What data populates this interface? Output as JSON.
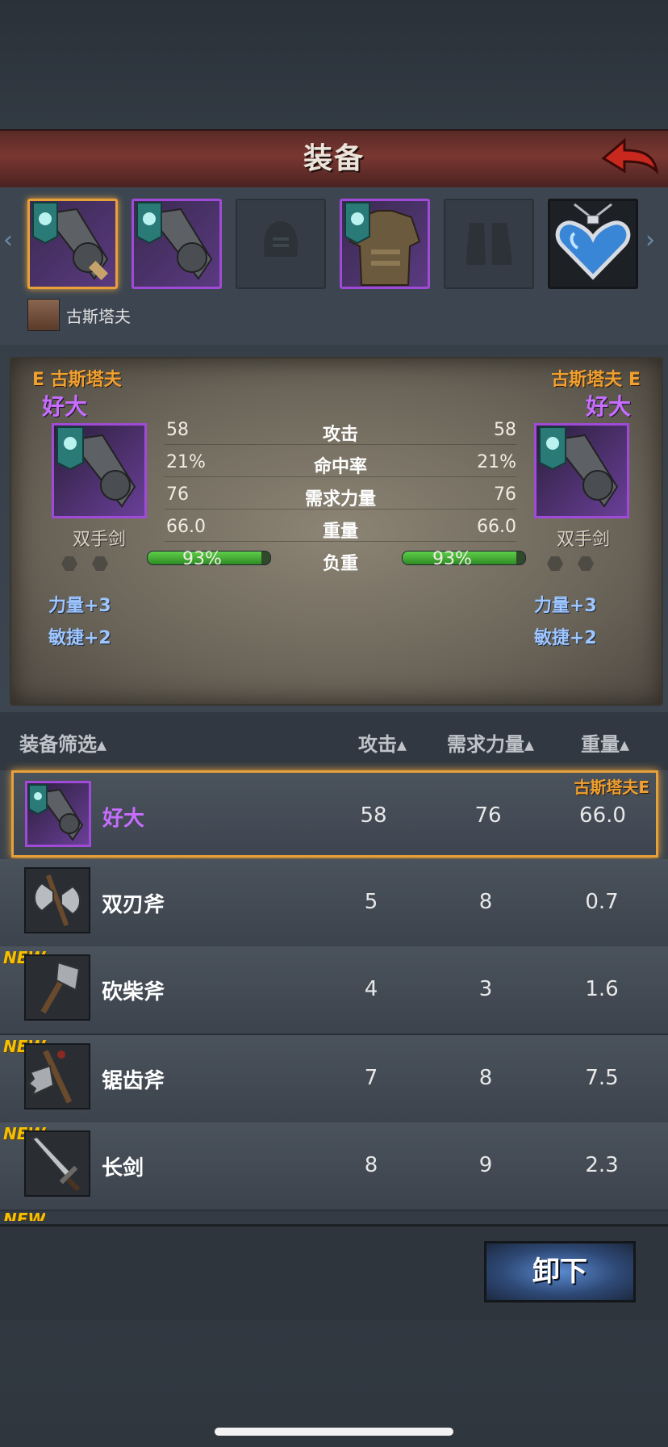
{
  "header": {
    "title": "装备",
    "back": "back"
  },
  "hero": {
    "name": "古斯塔夫"
  },
  "compare": {
    "left": {
      "owner": "E 古斯塔夫",
      "item_name": "好大",
      "type": "双手剑",
      "stats": [
        "58",
        "21%",
        "76",
        "66.0"
      ],
      "load_pct": "93%",
      "load_fraction": 0.93,
      "bonuses": [
        "力量+3",
        "敏捷+2"
      ]
    },
    "right": {
      "owner": "古斯塔夫 E",
      "item_name": "好大",
      "type": "双手剑",
      "stats": [
        "58",
        "21%",
        "76",
        "66.0"
      ],
      "load_pct": "93%",
      "load_fraction": 0.93,
      "bonuses": [
        "力量+3",
        "敏捷+2"
      ]
    },
    "labels": [
      "攻击",
      "命中率",
      "需求力量",
      "重量",
      "负重"
    ]
  },
  "list": {
    "headers": {
      "filter": "装备筛选",
      "attack": "攻击",
      "strength": "需求力量",
      "weight": "重量"
    },
    "selected_owner": "古斯塔夫E",
    "new_label": "NEW",
    "items": [
      {
        "name": "好大",
        "attack": "58",
        "strength": "76",
        "weight": "66.0"
      },
      {
        "name": "双刃斧",
        "attack": "5",
        "strength": "8",
        "weight": "0.7"
      },
      {
        "name": "砍柴斧",
        "attack": "4",
        "strength": "3",
        "weight": "1.6"
      },
      {
        "name": "锯齿斧",
        "attack": "7",
        "strength": "8",
        "weight": "7.5"
      },
      {
        "name": "长剑",
        "attack": "8",
        "strength": "9",
        "weight": "2.3"
      }
    ]
  },
  "actions": {
    "unequip": "卸下"
  },
  "colors": {
    "accent_orange": "#e8a03a",
    "rarity_purple": "#a04ad8",
    "name_purple": "#c76dff",
    "new_yellow": "#f6c000"
  }
}
